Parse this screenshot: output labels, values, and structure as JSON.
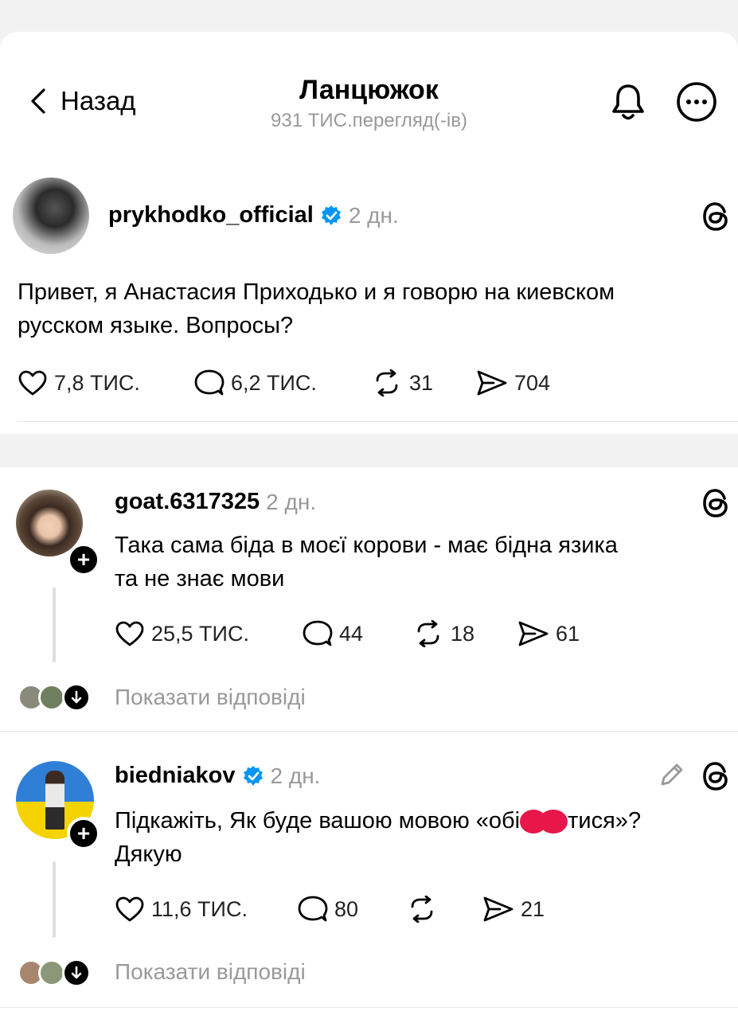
{
  "header": {
    "back_label": "Назад",
    "title": "Ланцюжок",
    "views": "931 ТИС.перегляд(-ів)",
    "icons": [
      "bell-icon",
      "more-icon"
    ]
  },
  "main_post": {
    "username": "prykhodko_official",
    "verified": true,
    "time": "2 дн.",
    "text_line1": "Привет, я Анастасия Приходько и я говорю на киевском",
    "text_line2": "русском языке. Вопросы?",
    "likes": "7,8 ТИС.",
    "comments": "6,2 ТИС.",
    "reposts": "31",
    "shares": "704"
  },
  "replies": [
    {
      "username": "goat.6317325",
      "verified": false,
      "time": "2 дн.",
      "text_line1": "Така сама біда в моєї корови - має бідна язика",
      "text_line2": "та не знає мови",
      "likes": "25,5 ТИС.",
      "comments": "44",
      "reposts": "18",
      "shares": "61",
      "show_replies": "Показати відповіді"
    },
    {
      "username": "biedniakov",
      "verified": true,
      "time": "2 дн.",
      "text_line1": "Підкажіть, Як буде вашою мовою «обі",
      "text_line1_end": "тися»?",
      "text_line2": "Дякую",
      "likes": "11,6 ТИС.",
      "comments": "80",
      "reposts": "",
      "shares": "21",
      "show_replies": "Показати відповіді"
    }
  ],
  "colors": {
    "verified": "#0095f6",
    "redaction": "#e8174b",
    "muted": "#999999"
  }
}
